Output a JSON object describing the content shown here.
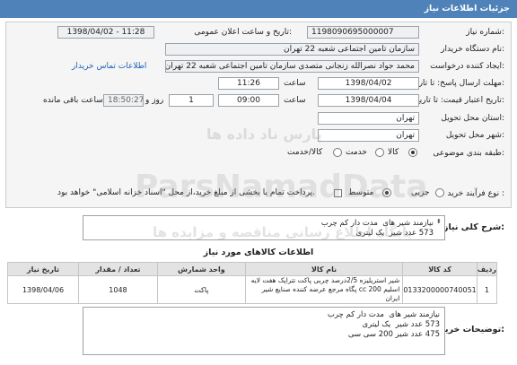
{
  "header": {
    "title": "جزئیات اطلاعات نیاز"
  },
  "form": {
    "need_number": {
      "label": "شماره نیاز:",
      "value": "1198090695000007"
    },
    "announce_datetime": {
      "label": "تاریخ و ساعت اعلان عمومی:",
      "value": "1398/04/02 - 11:28"
    },
    "buyer_org": {
      "label": "نام دستگاه خریدار:",
      "value": "سازمان تامین اجتماعی شعبه 22 تهران"
    },
    "requester": {
      "label": "ایجاد کننده درخواست:",
      "value": "محمد جواد نصرالله زنجانی متصدی سازمان تامین اجتماعی شعبه 22 تهران"
    },
    "contact_link": "اطلاعات تماس خریدار",
    "response_deadline": {
      "label": "مهلت ارسال پاسخ: تا تاریخ:",
      "date": "1398/04/02",
      "time_label": "ساعت",
      "time": "11:26"
    },
    "price_validity": {
      "label": "تاریخ اعتبار قیمت: تا تاریخ:",
      "date": "1398/04/04",
      "time_label": "ساعت",
      "time": "09:00",
      "days": "1",
      "days_label": "روز و",
      "remaining": "18:50:27",
      "remaining_label": "ساعت باقی مانده"
    },
    "province": {
      "label": "استان محل تحویل:",
      "value": "تهران"
    },
    "city": {
      "label": "شهر محل تحویل:",
      "value": "تهران"
    },
    "category": {
      "label": "طبقه بندی موضوعی:",
      "options": [
        "کالا",
        "خدمت",
        "کالا/خدمت"
      ],
      "selected": "کالا"
    },
    "process_type": {
      "label": "نوع فرآیند خرید :",
      "options": [
        "جزیی",
        "متوسط"
      ],
      "selected": "متوسط",
      "payment_note": "پرداخت تمام یا بخشی از مبلغ خرید،از محل \"اسناد خزانه اسلامی\" خواهد بود."
    }
  },
  "general_description": {
    "label": "شرح کلی نیاز:",
    "text": "نیازمند شیر های  مدت دار کم چرب\n573 عدد شیر  یک لیتری"
  },
  "goods_section": {
    "title": "اطلاعات کالاهای مورد نیاز",
    "columns": [
      "ردیف",
      "کد کالا",
      "نام کالا",
      "واحد شمارش",
      "تعداد / مقدار",
      "تاریخ نیاز"
    ],
    "rows": [
      {
        "row": "1",
        "code": "0133200000740051",
        "name": "شیر استریلیزه 2/5درصد چربی پاکت تتراپک هفت لایه اسلیم 200 cc پگاه مرجع عرضه کننده صنایع شیر ایران",
        "unit": "پاکت",
        "qty": "1048",
        "date": "1398/04/06"
      }
    ]
  },
  "buyer_notes": {
    "label": "توضیحات خریدار:",
    "text": "نیازمند شیر های  مدت دار کم چرب\n573 عدد شیر  یک لیتری\n475 عدد شیر 200 سی سی"
  },
  "watermark": {
    "fa_top": "پارس ناد داده ها",
    "en": "ParsNamadData",
    "fa_bottom": "پایگاه اطلاع رسانی مناقصه و مزایده ها"
  }
}
